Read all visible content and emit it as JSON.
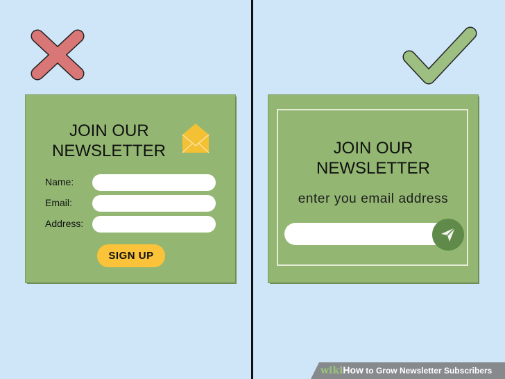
{
  "left_panel": {
    "status_icon": "x-icon",
    "title_line1": "JOIN OUR",
    "title_line2": "NEWSLETTER",
    "title_icon": "envelope-icon",
    "fields": [
      {
        "label": "Name:",
        "value": "",
        "placeholder": ""
      },
      {
        "label": "Email:",
        "value": "",
        "placeholder": ""
      },
      {
        "label": "Address:",
        "value": "",
        "placeholder": ""
      }
    ],
    "button_label": "SIGN UP"
  },
  "right_panel": {
    "status_icon": "checkmark-icon",
    "title_line1": "JOIN OUR",
    "title_line2": "NEWSLETTER",
    "subtitle": "enter you email address",
    "email_value": "",
    "email_placeholder": "",
    "send_icon": "send-icon"
  },
  "watermark": {
    "wiki": "wiki",
    "how": "How",
    "rest": " to Grow Newsletter Subscribers"
  },
  "colors": {
    "background": "#cfe5f8",
    "card_green": "#93b773",
    "x_red": "#d97777",
    "check_green": "#9dbf82",
    "button_yellow": "#fac33a",
    "send_green": "#5f8a4a"
  }
}
